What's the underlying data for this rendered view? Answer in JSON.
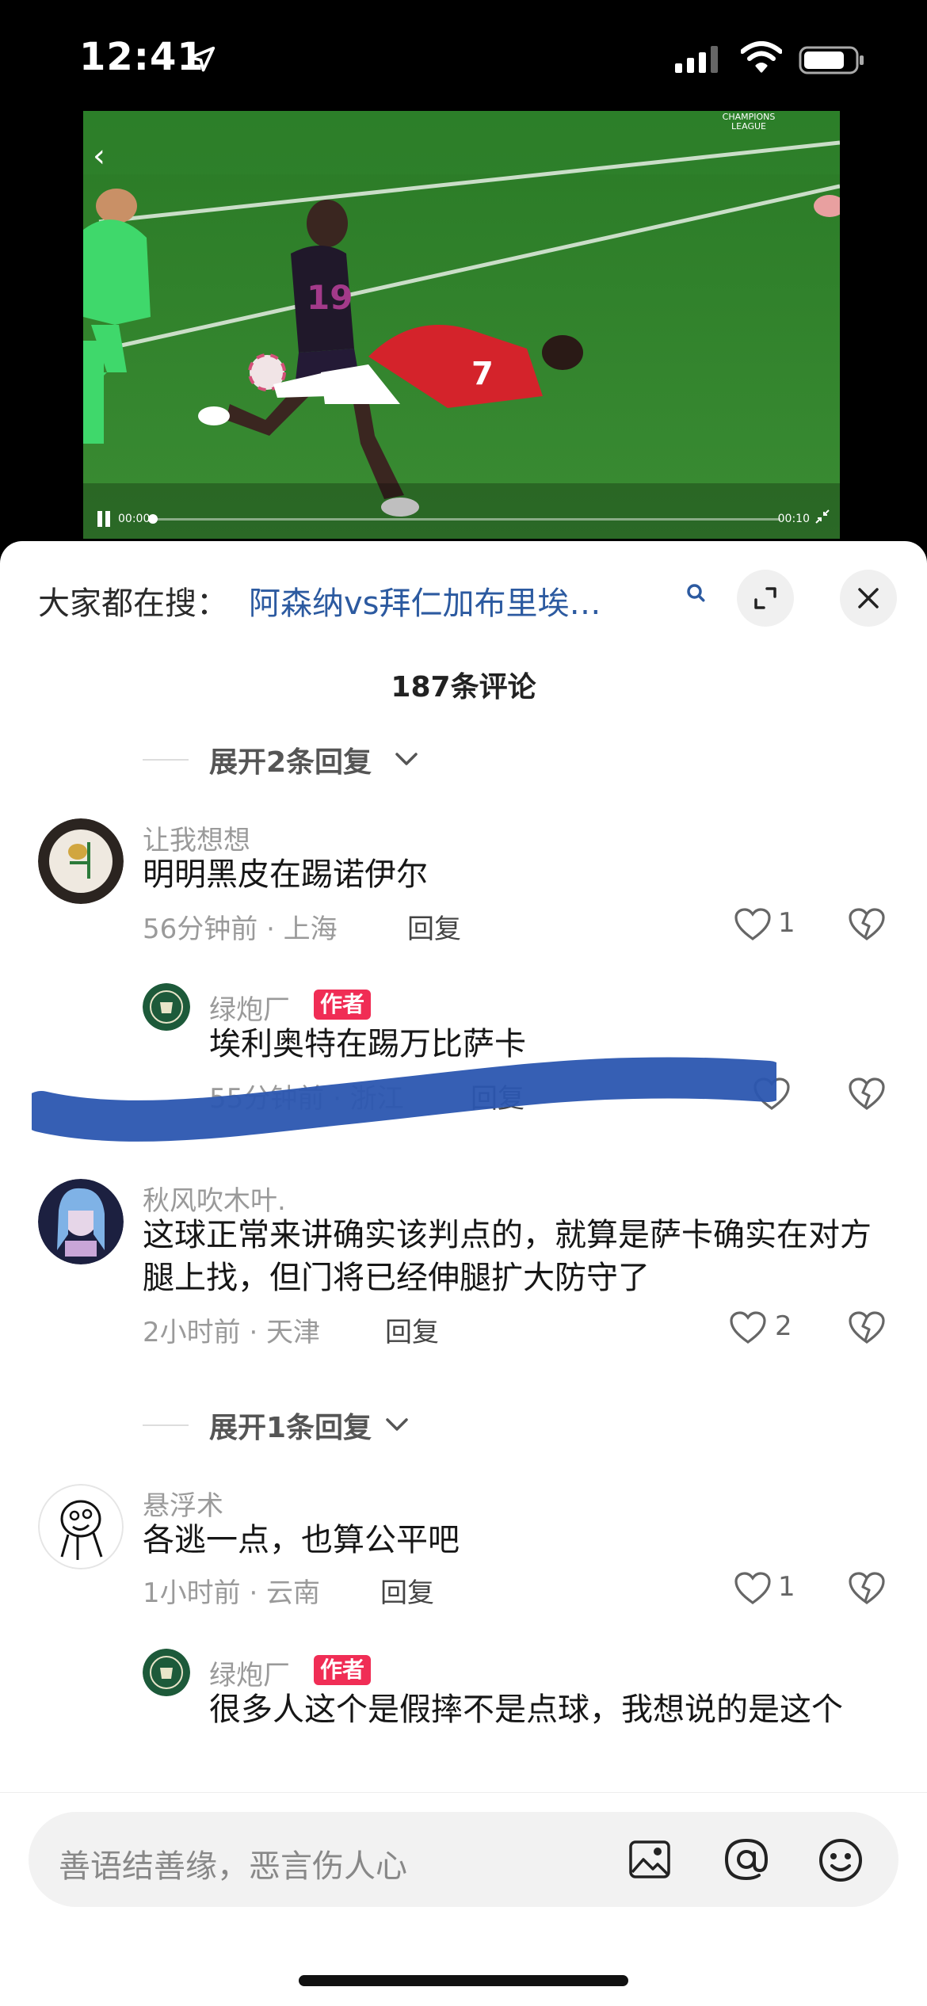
{
  "status_bar": {
    "time": "12:41"
  },
  "video": {
    "current_time": "00:00",
    "duration": "00:10",
    "progress": 0.0,
    "league_logo_text": "CHAMPIONS LEAGUE"
  },
  "search": {
    "prefix": "大家都在搜：",
    "query": "阿森纳vs拜仁加布里埃…"
  },
  "comments_header": {
    "count_label": "187条评论"
  },
  "expanders": [
    {
      "label": "展开2条回复"
    },
    {
      "label": "展开1条回复"
    }
  ],
  "comments": [
    {
      "username": "让我想想",
      "text": "明明黑皮在踢诺伊尔",
      "meta": "56分钟前 · 上海",
      "reply": "回复",
      "likes": "1"
    },
    {
      "username": "绿炮厂",
      "badge": "作者",
      "text": "埃利奥特在踢万比萨卡",
      "meta": "55分钟前 · 浙江",
      "reply": "回复",
      "likes": ""
    },
    {
      "username": "秋风吹木叶.",
      "text": "这球正常来讲确实该判点的，就算是萨卡确实在对方腿上找，但门将已经伸腿扩大防守了",
      "meta": "2小时前 · 天津",
      "reply": "回复",
      "likes": "2"
    },
    {
      "username": "悬浮术",
      "text": "各逃一点，也算公平吧",
      "meta": "1小时前 · 云南",
      "reply": "回复",
      "likes": "1"
    },
    {
      "username": "绿炮厂",
      "badge": "作者",
      "text": "很多人这个是假摔不是点球，我想说的是这个",
      "meta": "",
      "reply": "",
      "likes": ""
    }
  ],
  "input": {
    "placeholder": "善语结善缘，恶言伤人心"
  },
  "colors": {
    "link": "#2c5aa0",
    "author_badge": "#f02d55",
    "scribble": "#2b56b0"
  }
}
